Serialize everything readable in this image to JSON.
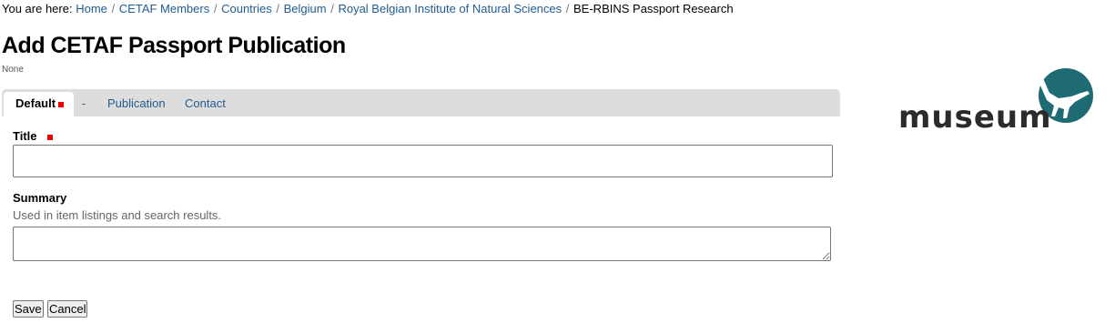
{
  "breadcrumb": {
    "prefix": "You are here:",
    "links": [
      "Home",
      "CETAF Members",
      "Countries",
      "Belgium",
      "Royal Belgian Institute of Natural Sciences"
    ],
    "current": "BE-RBINS Passport Research",
    "separator": "/"
  },
  "page": {
    "title": "Add CETAF Passport Publication",
    "description": "None"
  },
  "tabs": [
    {
      "label": "Default",
      "active": true,
      "required": true
    },
    {
      "label": "-"
    },
    {
      "label": "Publication"
    },
    {
      "label": "Contact"
    }
  ],
  "form": {
    "title": {
      "label": "Title",
      "value": "",
      "required": true
    },
    "summary": {
      "label": "Summary",
      "help": "Used in item listings and search results.",
      "value": ""
    }
  },
  "buttons": {
    "save": "Save",
    "cancel": "Cancel"
  },
  "logo": {
    "text": "museum",
    "colors": {
      "text": "#2b2b2b",
      "accent": "#1f6b73"
    }
  },
  "colors": {
    "link": "#205c90",
    "required": "#e00000",
    "tabbar": "#dddddd"
  }
}
